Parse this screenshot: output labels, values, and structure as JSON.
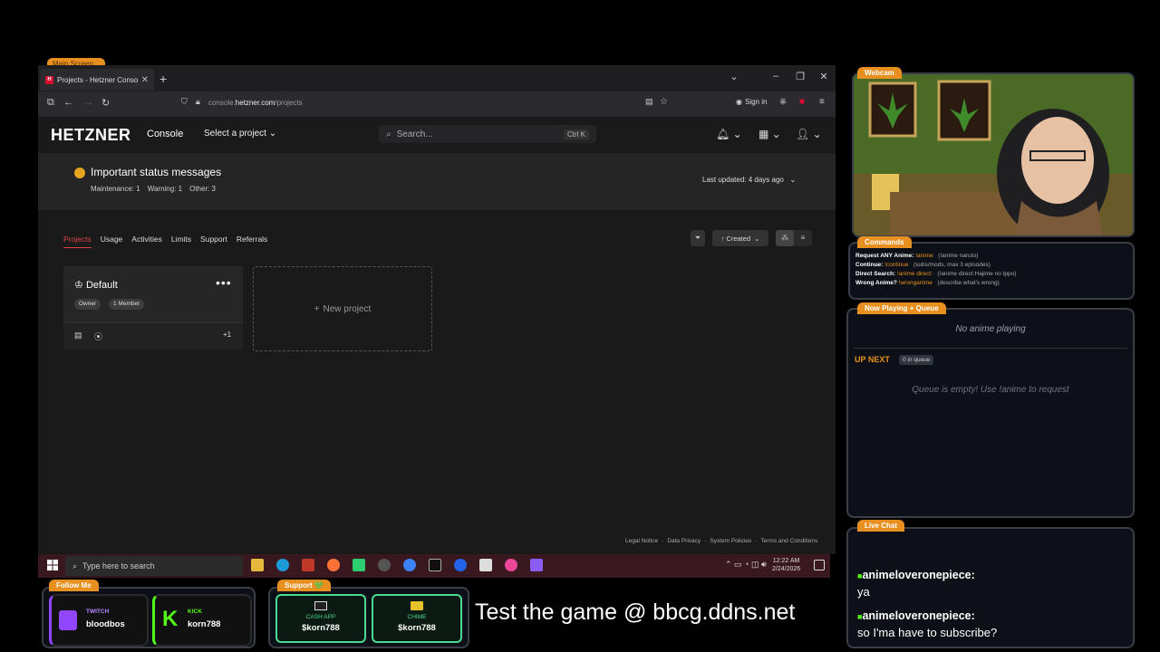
{
  "browser": {
    "main_screen_label": "Main Screen",
    "tab_title": "Projects - Hetzner Console",
    "url_prefix": "console.",
    "url_domain": "hetzner.com",
    "url_path": "/projects",
    "sign_in": "Sign in"
  },
  "hetzner": {
    "logo": "HETZNER",
    "console_label": "Console",
    "project_select": "Select a project",
    "search_placeholder": "Search...",
    "search_shortcut": "Ctrl K",
    "status": {
      "title": "Important status messages",
      "maintenance": "Maintenance: 1",
      "warning": "Warning: 1",
      "other": "Other: 3",
      "last_updated": "Last updated: 4 days ago"
    },
    "tabs": [
      "Projects",
      "Usage",
      "Activities",
      "Limits",
      "Support",
      "Referrals"
    ],
    "sort_label": "↑ Created",
    "project": {
      "name": "Default",
      "role_badge": "Owner",
      "member_badge": "1 Member",
      "extra_count": "+1"
    },
    "new_project": "New project",
    "footer_links": [
      "Legal Notice",
      "Data Privacy",
      "System Policies",
      "Terms and Conditions"
    ]
  },
  "taskbar": {
    "search_placeholder": "Type here to search",
    "time": "12:22 AM",
    "date": "2/24/2026"
  },
  "overlay": {
    "webcam_tag": "Webcam",
    "commands_tag": "Commands",
    "commands": [
      {
        "label": "Request ANY Anime:",
        "cmd": "!anime",
        "desc": "(!anime naruto)"
      },
      {
        "label": "Continue:",
        "cmd": "!continue",
        "desc": "(subs/mods, max 3 episodes)"
      },
      {
        "label": "Direct Search:",
        "cmd": "!anime direct:",
        "desc": "(!anime direct:Hajime no Ippo)"
      },
      {
        "label": "Wrong Anime?",
        "cmd": "!wronganime",
        "desc": "(describe what's wrong)"
      }
    ],
    "now_playing_tag": "Now Playing + Queue",
    "now_playing": "No anime playing",
    "up_next": "UP NEXT",
    "queue_count": "0 in queue",
    "queue_empty": "Queue is empty! Use !anime to request",
    "live_chat_tag": "Live Chat",
    "chat": [
      {
        "user": "animeloveronepiece:",
        "msg": "ya"
      },
      {
        "user": "animeloveronepiece:",
        "msg": "so I'ma have to subscribe?"
      }
    ],
    "follow_tag": "Follow Me",
    "twitch_label": "TWITCH",
    "twitch_user": "bloodbos",
    "kick_label": "KICK",
    "kick_user": "korn788",
    "support_tag": "Support 💚",
    "cashapp_label": "CASH APP",
    "cashapp_user": "$korn788",
    "chime_label": "CHIME",
    "chime_user": "$korn788",
    "promo": "Test the game @ bbcg.ddns.net"
  },
  "colors": {
    "accent_orange": "#e7901f",
    "hetzner_red": "#d50c2d",
    "status_yellow": "#e7a51f",
    "kick_green": "#53fc18",
    "twitch_purple": "#9146ff"
  }
}
